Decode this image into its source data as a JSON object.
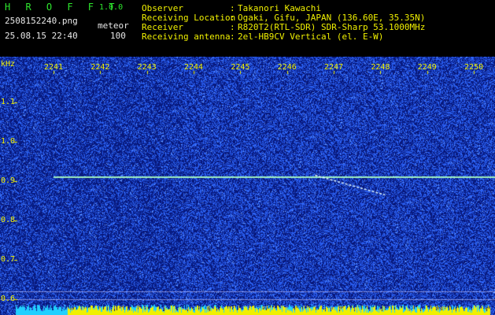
{
  "header": {
    "app_title": "H R O F F T",
    "app_version": "1.0.0",
    "file_name": "2508152240.png",
    "datetime": "25.08.15 22:40",
    "mode_label": "meteor",
    "mode_value": "100",
    "info": [
      {
        "key": "Observer",
        "value": "Takanori Kawachi"
      },
      {
        "key": "Receiving Location",
        "value": "Ogaki, Gifu, JAPAN (136.60E, 35.35N)"
      },
      {
        "key": "Receiver",
        "value": "R820T2(RTL-SDR) SDR-Sharp 53.1000MHz"
      },
      {
        "key": "Receiving antenna",
        "value": "2el-HB9CV Vertical (el. E-W)"
      }
    ],
    "separator": ":"
  },
  "chart_data": {
    "type": "heatmap",
    "ylabel": "kHz",
    "y_ticks": [
      "1.1",
      "1.0",
      "0.9",
      "0.8",
      "0.7",
      "0.6"
    ],
    "x_ticks": [
      "2241",
      "2242",
      "2243",
      "2244",
      "2245",
      "2246",
      "2247",
      "2248",
      "2249",
      "2250"
    ],
    "ylim": [
      0.58,
      1.2
    ],
    "xlim": [
      2240.1,
      2250.4
    ],
    "carrier_khz": 0.91,
    "carrier_start": 2241.0,
    "meteor_echo": {
      "start": [
        2246.6,
        0.915
      ],
      "end": [
        2248.1,
        0.865
      ]
    },
    "colors": {
      "background": "#0c1a8a",
      "noise": "#2b4cf0",
      "carrier": "#9ff0c0",
      "echo": "#e0f8ff",
      "tick_text": "#f0f000",
      "level_bar_low": "#20d0ff",
      "level_bar_high": "#f0f000"
    }
  }
}
